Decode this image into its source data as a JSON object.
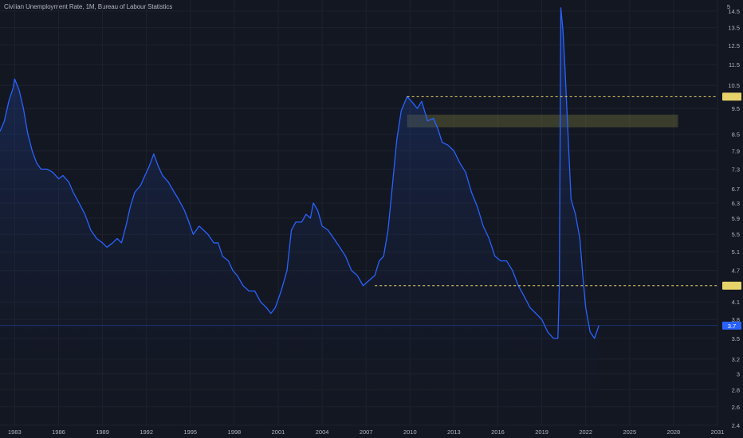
{
  "header": {
    "title": "Civilian Unemployment Rate, 1M, Bureau of Labour Statistics"
  },
  "colors": {
    "background": "#131722",
    "line": "#2962ff",
    "fill": "#1e3a8a",
    "highlight": "#e6d36a",
    "current_label_bg": "#2962ff",
    "axis_text": "#b2b5be"
  },
  "chart_data": {
    "type": "area",
    "title": "Civilian Unemployment Rate, 1M, Bureau of Labour Statistics",
    "xlabel": "",
    "ylabel": "",
    "x_ticks": [
      "1983",
      "1986",
      "1989",
      "1992",
      "1995",
      "1998",
      "2001",
      "2004",
      "2007",
      "2010",
      "2013",
      "2016",
      "2019",
      "2022",
      "2025",
      "2028",
      "2031"
    ],
    "y_ticks": [
      "14.5",
      "13.5",
      "12.5",
      "11.5",
      "10.5",
      "9.5",
      "8.5",
      "7.9",
      "7.3",
      "6.7",
      "6.3",
      "5.9",
      "5.5",
      "5.1",
      "4.7",
      "4.1",
      "3.8",
      "3.5",
      "3.2",
      "3",
      "2.8",
      "2.6",
      "2.4"
    ],
    "y_top_label": "5",
    "xlim": [
      1982.0,
      2031.0
    ],
    "ylim": [
      2.4,
      14.8
    ],
    "scale": "log",
    "current_value_label": "3.7",
    "horizontal_levels": [
      {
        "value": 10.0,
        "label": "",
        "style": "dashed",
        "start_x": 2009.8
      },
      {
        "value": 4.4,
        "label": "",
        "style": "dashed",
        "start_x": 2007.6
      }
    ],
    "zone": {
      "x_start": 2009.8,
      "x_end": 2028.3,
      "y_low": 8.75,
      "y_high": 9.25
    },
    "grid": true,
    "series": [
      {
        "values": [
          [
            1982.0,
            8.6
          ],
          [
            1982.3,
            9.0
          ],
          [
            1982.6,
            9.8
          ],
          [
            1982.9,
            10.4
          ],
          [
            1983.0,
            10.8
          ],
          [
            1983.3,
            10.3
          ],
          [
            1983.6,
            9.5
          ],
          [
            1983.9,
            8.5
          ],
          [
            1984.2,
            7.9
          ],
          [
            1984.5,
            7.5
          ],
          [
            1984.8,
            7.3
          ],
          [
            1985.2,
            7.3
          ],
          [
            1985.6,
            7.2
          ],
          [
            1986.0,
            7.0
          ],
          [
            1986.3,
            7.1
          ],
          [
            1986.7,
            6.9
          ],
          [
            1987.0,
            6.6
          ],
          [
            1987.4,
            6.3
          ],
          [
            1987.8,
            6.0
          ],
          [
            1988.2,
            5.6
          ],
          [
            1988.6,
            5.4
          ],
          [
            1989.0,
            5.3
          ],
          [
            1989.3,
            5.2
          ],
          [
            1989.7,
            5.3
          ],
          [
            1990.0,
            5.4
          ],
          [
            1990.3,
            5.3
          ],
          [
            1990.6,
            5.7
          ],
          [
            1990.9,
            6.2
          ],
          [
            1991.2,
            6.6
          ],
          [
            1991.6,
            6.8
          ],
          [
            1991.9,
            7.1
          ],
          [
            1992.2,
            7.4
          ],
          [
            1992.5,
            7.8
          ],
          [
            1992.8,
            7.4
          ],
          [
            1993.1,
            7.1
          ],
          [
            1993.5,
            6.9
          ],
          [
            1993.9,
            6.6
          ],
          [
            1994.2,
            6.4
          ],
          [
            1994.6,
            6.1
          ],
          [
            1994.9,
            5.8
          ],
          [
            1995.2,
            5.5
          ],
          [
            1995.6,
            5.7
          ],
          [
            1995.9,
            5.6
          ],
          [
            1996.2,
            5.5
          ],
          [
            1996.6,
            5.3
          ],
          [
            1996.9,
            5.3
          ],
          [
            1997.2,
            5.0
          ],
          [
            1997.6,
            4.9
          ],
          [
            1997.9,
            4.7
          ],
          [
            1998.2,
            4.6
          ],
          [
            1998.6,
            4.4
          ],
          [
            1999.0,
            4.3
          ],
          [
            1999.4,
            4.3
          ],
          [
            1999.8,
            4.1
          ],
          [
            2000.2,
            4.0
          ],
          [
            2000.5,
            3.9
          ],
          [
            2000.8,
            4.0
          ],
          [
            2001.2,
            4.3
          ],
          [
            2001.6,
            4.7
          ],
          [
            2001.9,
            5.6
          ],
          [
            2002.2,
            5.8
          ],
          [
            2002.6,
            5.8
          ],
          [
            2002.9,
            6.0
          ],
          [
            2003.2,
            5.9
          ],
          [
            2003.4,
            6.3
          ],
          [
            2003.7,
            6.1
          ],
          [
            2004.0,
            5.7
          ],
          [
            2004.4,
            5.6
          ],
          [
            2004.8,
            5.4
          ],
          [
            2005.2,
            5.2
          ],
          [
            2005.6,
            5.0
          ],
          [
            2006.0,
            4.7
          ],
          [
            2006.4,
            4.6
          ],
          [
            2006.8,
            4.4
          ],
          [
            2007.2,
            4.5
          ],
          [
            2007.6,
            4.6
          ],
          [
            2007.9,
            4.9
          ],
          [
            2008.2,
            5.0
          ],
          [
            2008.5,
            5.6
          ],
          [
            2008.8,
            6.8
          ],
          [
            2009.1,
            8.3
          ],
          [
            2009.4,
            9.4
          ],
          [
            2009.8,
            10.0
          ],
          [
            2010.1,
            9.8
          ],
          [
            2010.5,
            9.5
          ],
          [
            2010.8,
            9.8
          ],
          [
            2011.2,
            9.0
          ],
          [
            2011.6,
            9.1
          ],
          [
            2011.9,
            8.7
          ],
          [
            2012.2,
            8.2
          ],
          [
            2012.6,
            8.1
          ],
          [
            2013.0,
            7.9
          ],
          [
            2013.4,
            7.5
          ],
          [
            2013.8,
            7.2
          ],
          [
            2014.2,
            6.6
          ],
          [
            2014.6,
            6.2
          ],
          [
            2015.0,
            5.7
          ],
          [
            2015.4,
            5.4
          ],
          [
            2015.8,
            5.0
          ],
          [
            2016.2,
            4.9
          ],
          [
            2016.6,
            4.9
          ],
          [
            2017.0,
            4.7
          ],
          [
            2017.4,
            4.4
          ],
          [
            2017.8,
            4.2
          ],
          [
            2018.2,
            4.0
          ],
          [
            2018.6,
            3.9
          ],
          [
            2019.0,
            3.8
          ],
          [
            2019.4,
            3.6
          ],
          [
            2019.8,
            3.5
          ],
          [
            2020.1,
            3.5
          ],
          [
            2020.2,
            4.4
          ],
          [
            2020.3,
            14.7
          ],
          [
            2020.45,
            13.3
          ],
          [
            2020.6,
            11.1
          ],
          [
            2020.8,
            8.4
          ],
          [
            2021.0,
            6.4
          ],
          [
            2021.3,
            6.0
          ],
          [
            2021.6,
            5.4
          ],
          [
            2021.8,
            4.6
          ],
          [
            2022.0,
            4.0
          ],
          [
            2022.3,
            3.6
          ],
          [
            2022.6,
            3.5
          ],
          [
            2022.9,
            3.7
          ]
        ]
      }
    ]
  }
}
